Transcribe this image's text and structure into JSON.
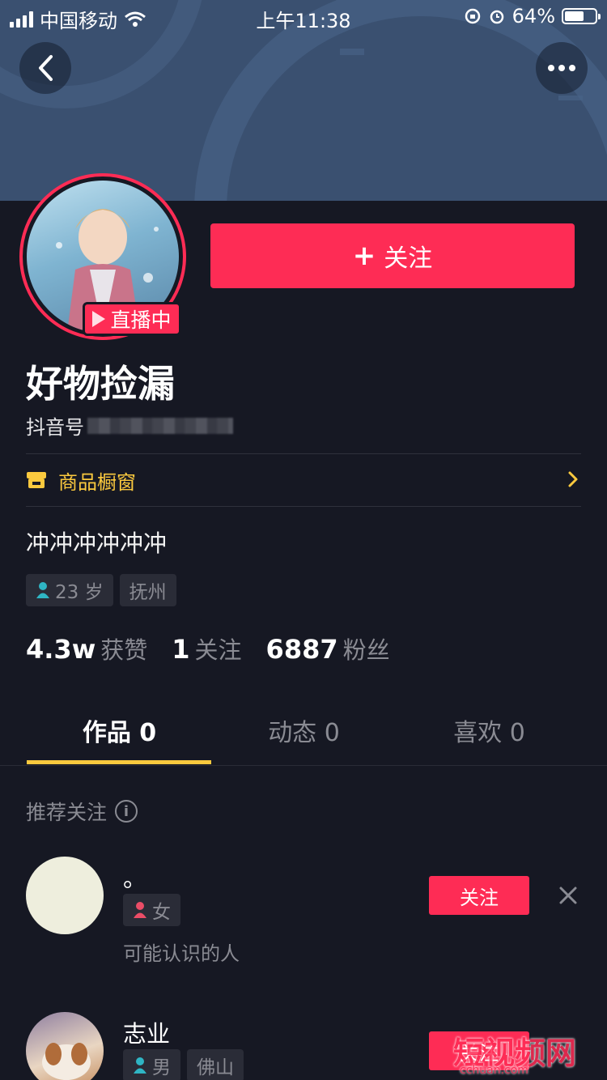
{
  "status_bar": {
    "carrier": "中国移动",
    "time": "上午11:38",
    "battery_percent": "64%",
    "battery_level": 0.64
  },
  "header": {
    "back_icon": "chevron-left-icon",
    "more_icon": "more-dots-icon"
  },
  "profile": {
    "live_badge": "直播中",
    "follow_label": "关注",
    "follow_plus": "+",
    "nickname": "好物捡漏",
    "douyin_id_label": "抖音号",
    "shop_label": "商品橱窗",
    "bio": "冲冲冲冲冲冲",
    "age": "23 岁",
    "location": "抚州",
    "stats": {
      "likes_value": "4.3w",
      "likes_label": "获赞",
      "following_value": "1",
      "following_label": "关注",
      "followers_value": "6887",
      "followers_label": "粉丝"
    }
  },
  "tabs": [
    {
      "label": "作品 0"
    },
    {
      "label": "动态 0"
    },
    {
      "label": "喜欢 0"
    }
  ],
  "recommend": {
    "title": "推荐关注",
    "items": [
      {
        "name": "。",
        "gender": "女",
        "subtitle": "可能认识的人",
        "follow": "关注"
      },
      {
        "name": "志业",
        "gender": "男",
        "location": "佛山",
        "follow": "关注"
      }
    ]
  },
  "watermark": {
    "text": "短视频网",
    "url": "cchuan.com"
  },
  "colors": {
    "accent": "#fe2c55",
    "background": "#161823",
    "gold": "#fbc93e",
    "muted": "#8a8b93"
  }
}
